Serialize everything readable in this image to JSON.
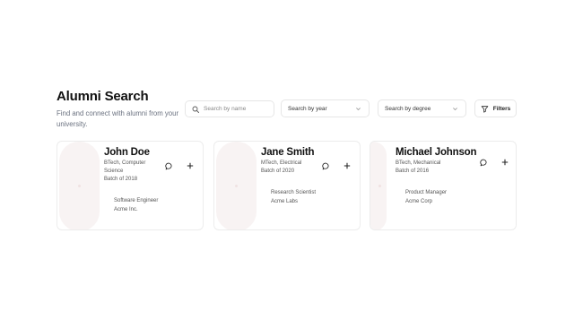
{
  "page": {
    "title": "Alumni Search",
    "subtitle": "Find and connect with alumni from your university."
  },
  "search": {
    "placeholder": "Search by name",
    "value": ""
  },
  "filters": {
    "year": {
      "selected": "Search by year"
    },
    "degree": {
      "selected": "Search by degree"
    },
    "button_label": "Filters"
  },
  "icons": {
    "search": "search-icon",
    "chevron": "chevron-down-icon",
    "filter": "filter-icon",
    "message": "message-icon",
    "add": "plus-icon"
  },
  "alumni": [
    {
      "name": "John Doe",
      "degree": "BTech, Computer Science",
      "batch": "Batch of 2018",
      "role": "Software Engineer",
      "company": "Acme Inc."
    },
    {
      "name": "Jane Smith",
      "degree": "MTech, Electrical",
      "batch": "Batch of 2020",
      "role": "Research Scientist",
      "company": "Acme Labs"
    },
    {
      "name": "Michael Johnson",
      "degree": "BTech, Mechanical",
      "batch": "Batch of 2016",
      "role": "Product Manager",
      "company": "Acme Corp"
    }
  ]
}
